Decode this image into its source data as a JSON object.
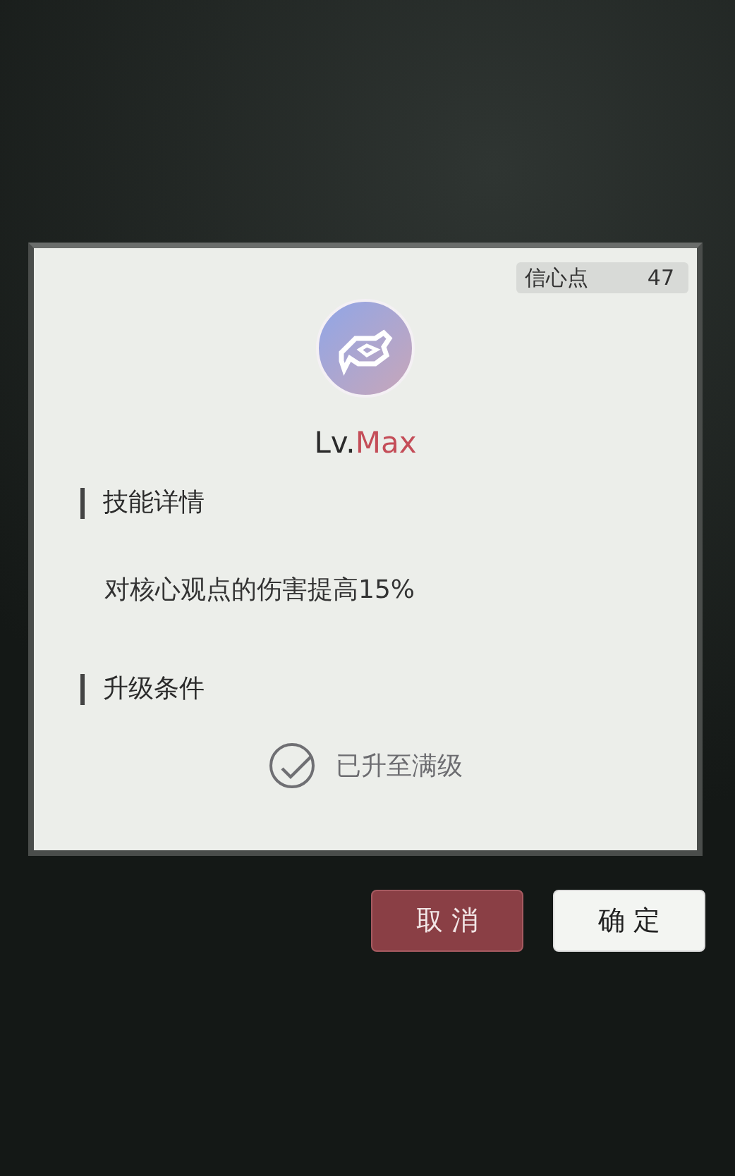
{
  "currency": {
    "label": "信心点",
    "value": "47"
  },
  "skill": {
    "level_prefix": "Lv.",
    "level_value": "Max"
  },
  "sections": [
    {
      "title": "技能详情",
      "kind": "text",
      "text": "对核心观点的伤害提高15%"
    },
    {
      "title": "升级条件",
      "kind": "status",
      "text": "已升至满级",
      "done": true
    }
  ],
  "buttons": [
    {
      "label": "取 消",
      "kind": "cancel"
    },
    {
      "label": "确 定",
      "kind": "confirm"
    }
  ]
}
